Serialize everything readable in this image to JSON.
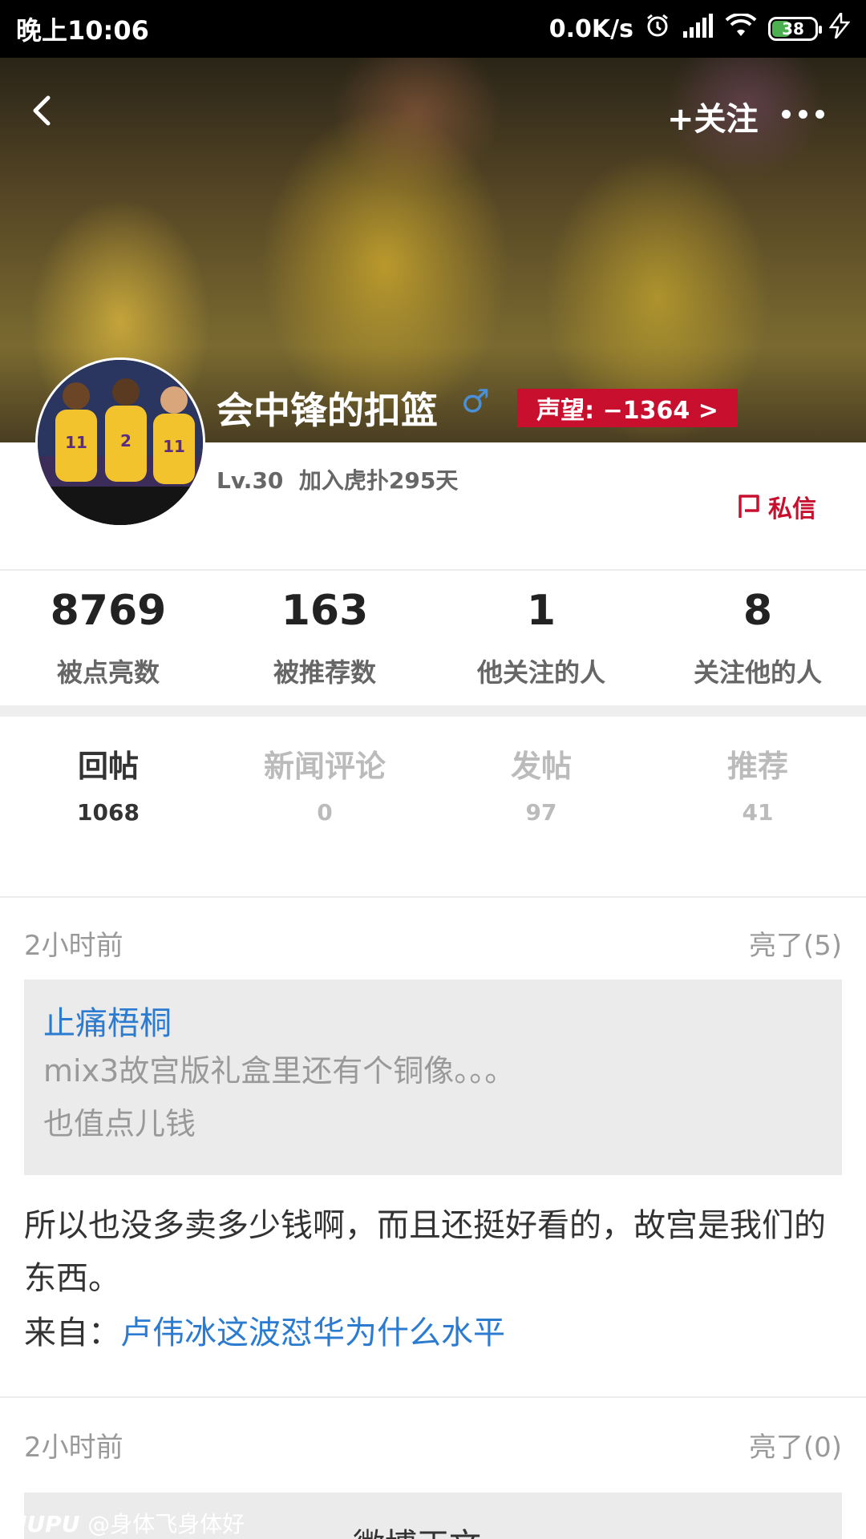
{
  "status_bar": {
    "time": "晚上10:06",
    "network_speed": "0.0K/s",
    "battery": "38"
  },
  "header": {
    "back_icon": "chevron-left-icon",
    "follow_label": "+关注",
    "more_icon": "more-dots-icon"
  },
  "profile": {
    "username": "会中锋的扣篮",
    "gender_icon": "♂",
    "reputation": "声望: −1364 >",
    "level": "Lv.30",
    "joined": "加入虎扑295天",
    "dm_label": "私信"
  },
  "stats": [
    {
      "value": "8769",
      "label": "被点亮数"
    },
    {
      "value": "163",
      "label": "被推荐数"
    },
    {
      "value": "1",
      "label": "他关注的人"
    },
    {
      "value": "8",
      "label": "关注他的人"
    }
  ],
  "tabs": [
    {
      "label": "回帖",
      "count": "1068"
    },
    {
      "label": "新闻评论",
      "count": "0"
    },
    {
      "label": "发帖",
      "count": "97"
    },
    {
      "label": "推荐",
      "count": "41"
    }
  ],
  "posts": [
    {
      "time": "2小时前",
      "likes": "亮了(5)",
      "quote_author": "止痛梧桐",
      "quote_line1": "mix3故宫版礼盒里还有个铜像。。。",
      "quote_line2": "也值点儿钱",
      "body": "所以也没多卖多少钱啊，而且还挺好看的，故宫是我们的东西。",
      "from_label": "来自：",
      "from_link": "卢伟冰这波怼华为什么水平"
    },
    {
      "time": "2小时前",
      "likes": "亮了(0)",
      "quote_partial": "微博正文"
    }
  ],
  "watermark": {
    "brand": "HUPU",
    "handle": "@身体飞身体好"
  },
  "colors": {
    "accent_red": "#c8102e",
    "link_blue": "#2b7bd1"
  }
}
